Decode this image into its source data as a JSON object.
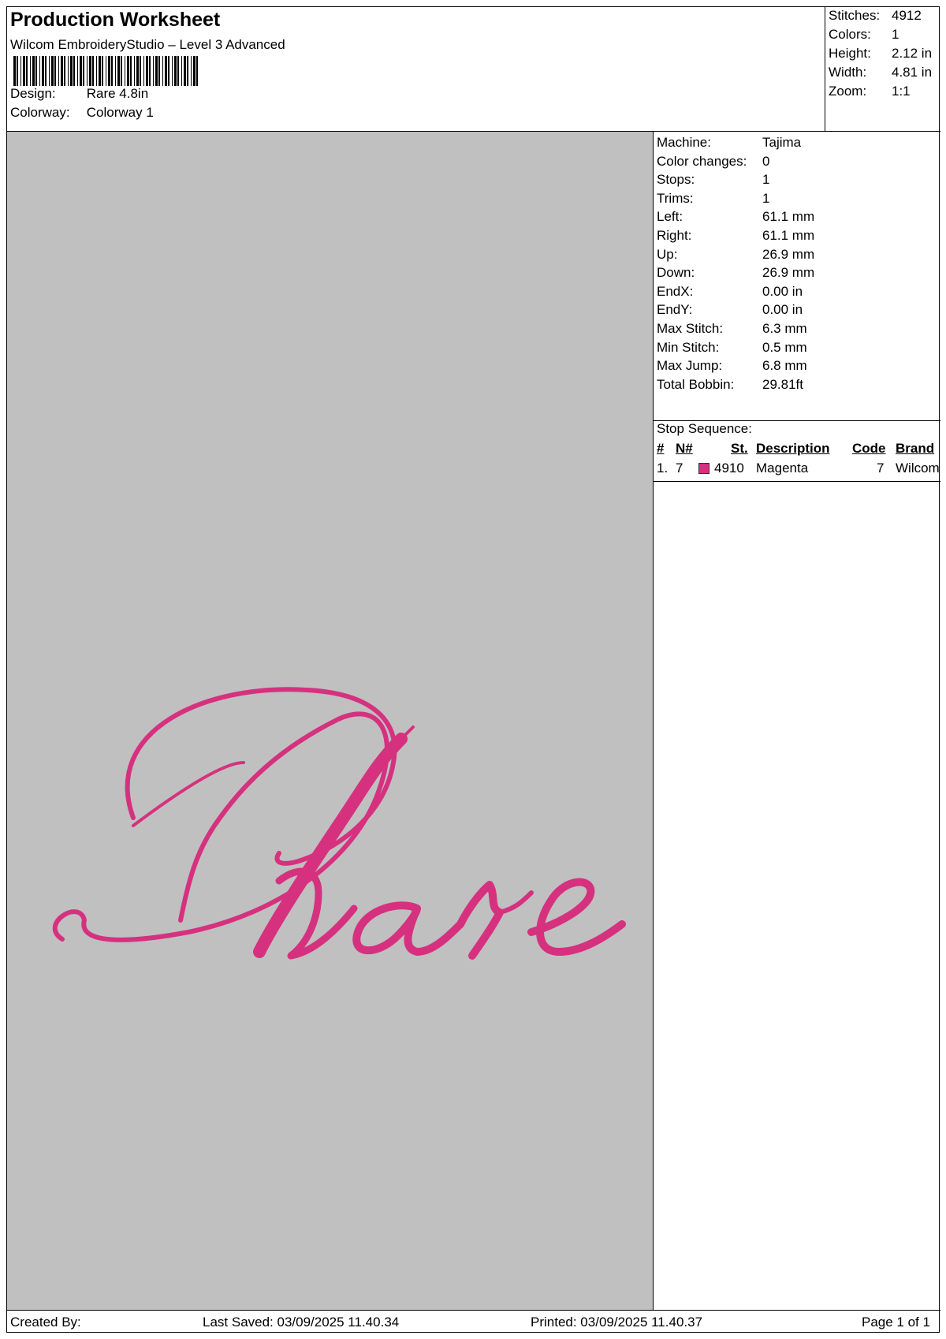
{
  "header": {
    "title": "Production Worksheet",
    "software": "Wilcom EmbroideryStudio – Level 3 Advanced",
    "design_label": "Design:",
    "design_value": "Rare 4.8in",
    "colorway_label": "Colorway:",
    "colorway_value": "Colorway 1"
  },
  "summary": {
    "stitches_label": "Stitches:",
    "stitches": "4912",
    "colors_label": "Colors:",
    "colors": "1",
    "height_label": "Height:",
    "height": "2.12 in",
    "width_label": "Width:",
    "width": "4.81 in",
    "zoom_label": "Zoom:",
    "zoom": "1:1"
  },
  "design_preview": {
    "text": "Rare",
    "thread_color": "#d6317f",
    "background_color": "#c0c0c0"
  },
  "stats": [
    {
      "label": "Machine:",
      "value": "Tajima"
    },
    {
      "label": "Color changes:",
      "value": "0"
    },
    {
      "label": "Stops:",
      "value": "1"
    },
    {
      "label": "Trims:",
      "value": "1"
    },
    {
      "label": "Left:",
      "value": "61.1 mm"
    },
    {
      "label": "Right:",
      "value": "61.1 mm"
    },
    {
      "label": "Up:",
      "value": "26.9 mm"
    },
    {
      "label": "Down:",
      "value": "26.9 mm"
    },
    {
      "label": "EndX:",
      "value": "0.00 in"
    },
    {
      "label": "EndY:",
      "value": "0.00 in"
    },
    {
      "label": "Max Stitch:",
      "value": "6.3 mm"
    },
    {
      "label": "Min Stitch:",
      "value": "0.5 mm"
    },
    {
      "label": "Max Jump:",
      "value": "6.8 mm"
    },
    {
      "label": "Total Bobbin:",
      "value": "29.81ft"
    }
  ],
  "stop_sequence": {
    "title": "Stop Sequence:",
    "headers": {
      "num": "#",
      "needle": "N#",
      "stitches": "St.",
      "description": "Description",
      "code": "Code",
      "brand": "Brand"
    },
    "rows": [
      {
        "num": "1.",
        "needle": "7",
        "color": "#d6317f",
        "stitches": "4910",
        "description": "Magenta",
        "code": "7",
        "brand": "Wilcom"
      }
    ]
  },
  "footer": {
    "created_by": "Created By:",
    "last_saved": "Last Saved: 03/09/2025 11.40.34",
    "printed": "Printed: 03/09/2025 11.40.37",
    "page": "Page 1 of 1"
  }
}
